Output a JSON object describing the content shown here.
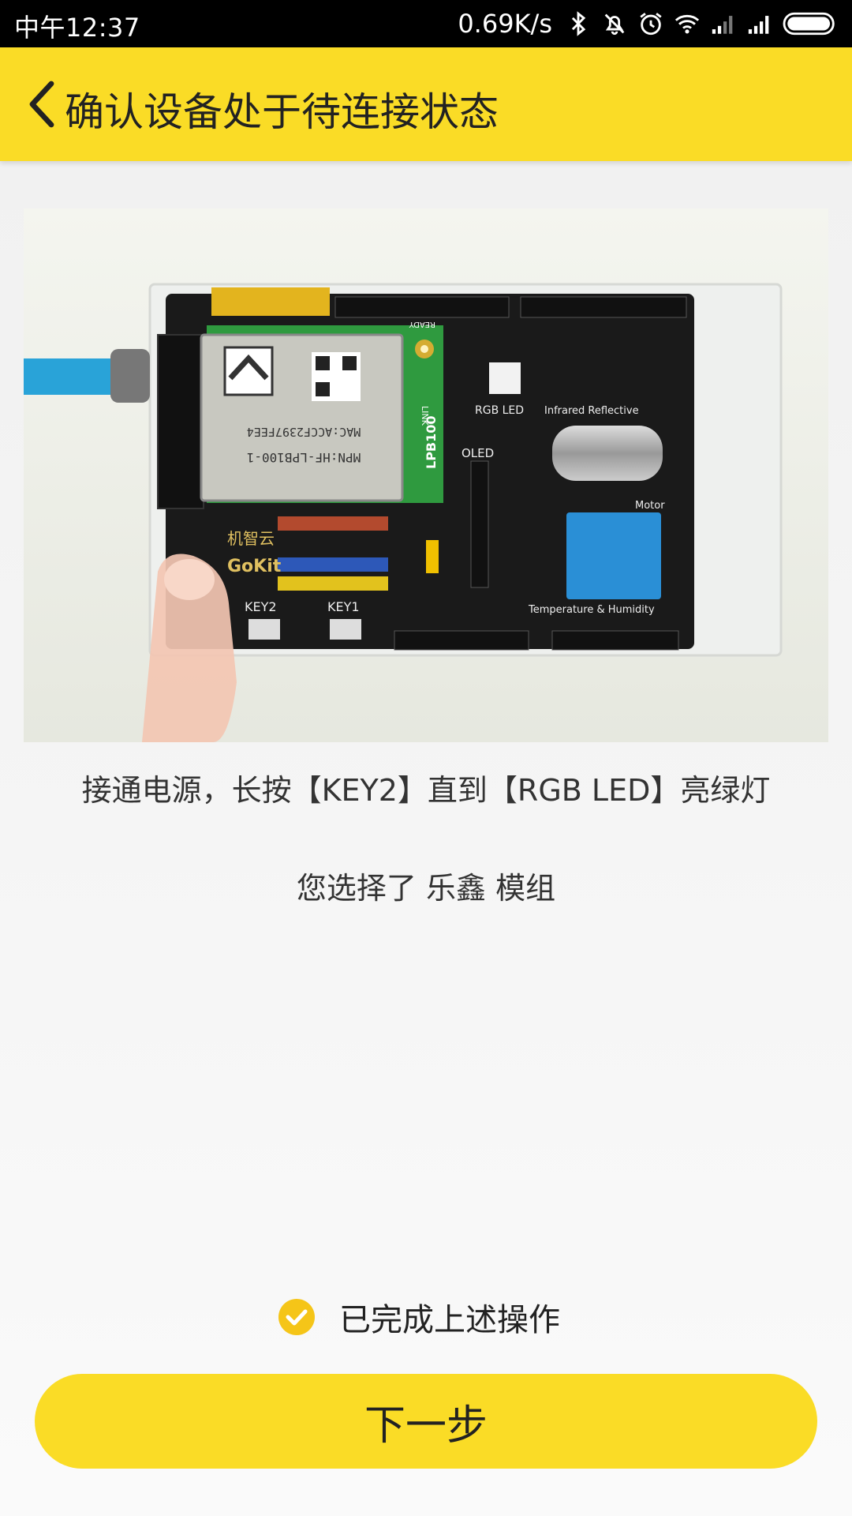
{
  "status_bar": {
    "time": "中午12:37",
    "net_speed": "0.69K/s",
    "icons": [
      "bluetooth-icon",
      "mute-icon",
      "alarm-icon",
      "wifi-icon",
      "signal-icon",
      "signal-icon",
      "battery-icon"
    ]
  },
  "header": {
    "title": "确认设备处于待连接状态",
    "back_icon": "chevron-left-icon"
  },
  "device_image": {
    "board_labels": {
      "brand": "机智云",
      "gokit": "GoKit",
      "key2": "KEY2",
      "key1": "KEY1",
      "rgb_led": "RGB LED",
      "infrared": "Infrared Reflective",
      "motor": "Motor",
      "temp_humidity": "Temperature & Humidity",
      "oled": "OLED",
      "module_mpn": "MPN:HF-LPB100-1",
      "module_mac": "MAC:ACCF2397FEE4",
      "lpb": "LPB100",
      "link": "LINK",
      "ready": "READY"
    }
  },
  "instruction": "接通电源，长按【KEY2】直到【RGB LED】亮绿灯",
  "selected_module": "您选择了 乐鑫 模组",
  "confirm": {
    "label": "已完成上述操作",
    "checked": true
  },
  "next_button": {
    "label": "下一步"
  },
  "colors": {
    "accent": "#fadc26",
    "status_bar": "#000000",
    "text": "#333333"
  }
}
